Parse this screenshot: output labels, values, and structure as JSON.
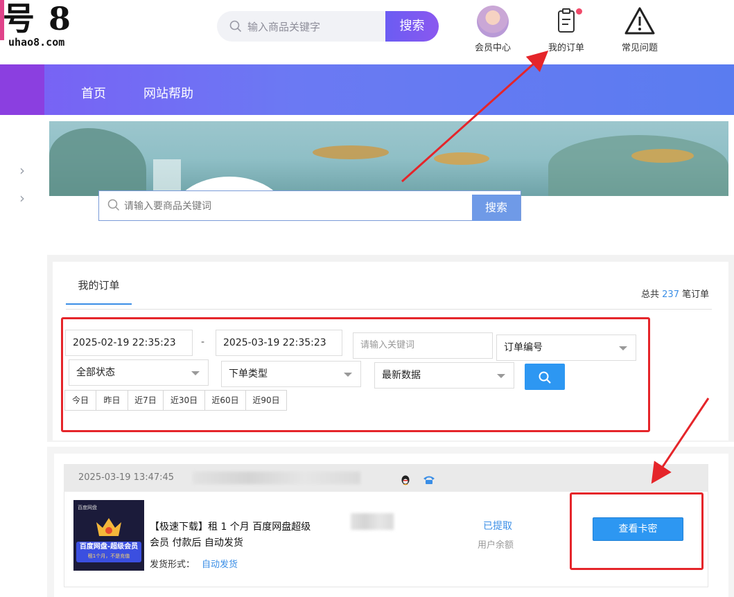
{
  "header": {
    "logo_mark": "号 8",
    "logo_brand": "uhao8.com",
    "search_placeholder": "输入商品关键字",
    "search_button": "搜索",
    "links": [
      {
        "label": "会员中心",
        "icon": "avatar"
      },
      {
        "label": "我的订单",
        "icon": "clipboard-icon"
      },
      {
        "label": "常见问题",
        "icon": "warning-icon"
      }
    ]
  },
  "nav": {
    "items": [
      "首页",
      "网站帮助"
    ]
  },
  "banner": {
    "search_placeholder": "请输入要商品关键词",
    "search_button": "搜索"
  },
  "orders": {
    "tab_label": "我的订单",
    "total_prefix": "总共",
    "total_count": "237",
    "total_suffix": "笔订单",
    "filters": {
      "date_from": "2025-02-19 22:35:23",
      "date_sep": "-",
      "date_to": "2025-03-19 22:35:23",
      "keyword_placeholder": "请输入关键词",
      "keyword_type": "订单编号",
      "status": "全部状态",
      "order_type": "下单类型",
      "sort": "最新数据"
    },
    "quick_dates": [
      "今日",
      "昨日",
      "近7日",
      "近30日",
      "近60日",
      "近90日"
    ]
  },
  "order_card": {
    "time": "2025-03-19 13:47:45",
    "product_image": {
      "brand": "百度网盘",
      "line1": "百度网盘-超级会员",
      "line2": "租1个月，不是充值"
    },
    "title": "【极速下载】租 1 个月 百度网盘超级会员 付款后 自动发货",
    "ship_label": "发货形式：",
    "ship_value": "自动发货",
    "status": "已提取",
    "status_sub": "用户余额",
    "action": "查看卡密"
  },
  "colors": {
    "accent": "#2d97f2",
    "nav_gradient_start": "#7a5ff5",
    "nav_gradient_end": "#5a7cf0",
    "annotation_red": "#e5252a"
  }
}
